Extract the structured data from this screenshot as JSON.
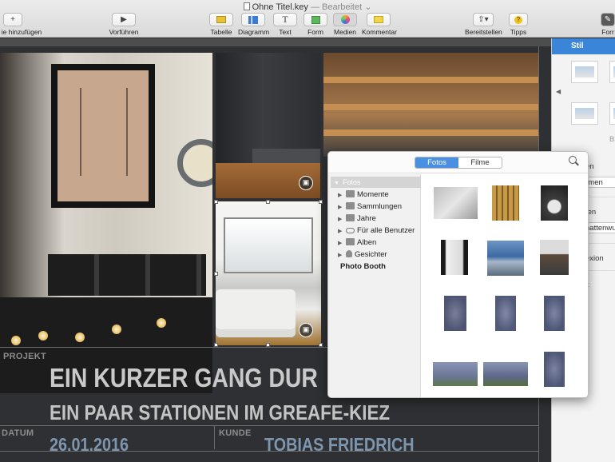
{
  "window": {
    "doc_title": "Ohne Titel.key",
    "doc_status": "— Bearbeitet"
  },
  "toolbar": {
    "add_slide_label": "ie hinzufügen",
    "play_label": "Vorführen",
    "table_label": "Tabelle",
    "chart_label": "Diagramm",
    "text_label": "Text",
    "shape_label": "Form",
    "media_label": "Medien",
    "comment_label": "Kommentar",
    "share_label": "Bereitstellen",
    "tips_label": "Tipps",
    "format_label": "Forr"
  },
  "slide": {
    "project_label": "PROJEKT",
    "headline": "EIN KURZER GANG DUR",
    "subheadline": "EIN PAAR STATIONEN IM GREAFE-KIEZ",
    "date_label": "DATUM",
    "date_value": "26.01.2016",
    "client_label": "KUNDE",
    "client_value": "TOBIAS FRIEDRICH"
  },
  "inspector": {
    "tab_label": "Stil",
    "frag_b": "B",
    "frag_1": "en",
    "frag_2": "hmen",
    "frag_3": "ten",
    "frag_4": "hattenwu",
    "frag_5": "exion",
    "frag_6": "t"
  },
  "media_browser": {
    "tabs": {
      "photos": "Fotos",
      "movies": "Filme"
    },
    "active_tab": "Fotos",
    "source_header": "Fotos",
    "sources": [
      {
        "label": "Momente",
        "icon": "landscape-icon"
      },
      {
        "label": "Sammlungen",
        "icon": "landscape-icon"
      },
      {
        "label": "Jahre",
        "icon": "calendar-icon"
      },
      {
        "label": "Für alle Benutzer",
        "icon": "cloud-icon"
      },
      {
        "label": "Alben",
        "icon": "album-icon"
      },
      {
        "label": "Gesichter",
        "icon": "person-icon"
      }
    ],
    "photo_booth": "Photo Booth"
  },
  "colors": {
    "accent": "#3b85d8",
    "slide_bg": "#2f3033",
    "headline": "#c9c9c9",
    "value_blue": "#7e95ae"
  }
}
